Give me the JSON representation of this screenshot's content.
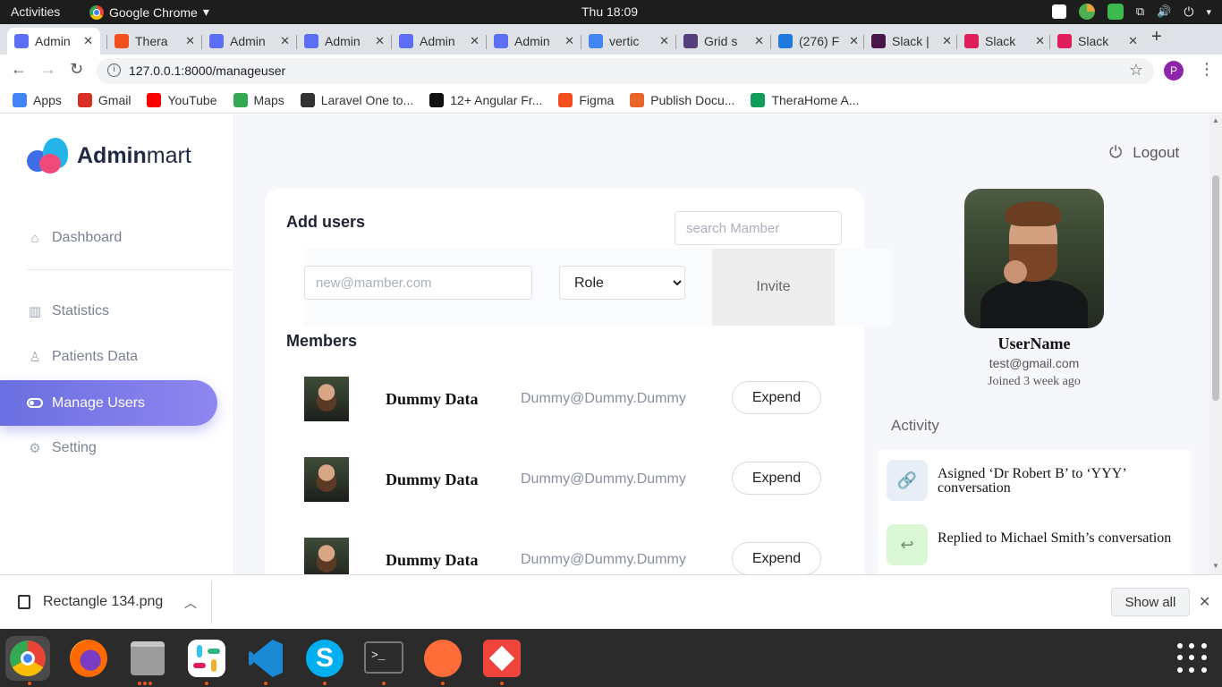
{
  "gnome": {
    "activities": "Activities",
    "app_name": "Google Chrome",
    "app_menu_arrow": "▾",
    "clock": "Thu 18:09"
  },
  "tabs": [
    {
      "title": "Admin",
      "icon": "adminmart-icon",
      "color": "#5b6ef5"
    },
    {
      "title": "Thera",
      "icon": "figma-icon",
      "color": "#f24e1e"
    },
    {
      "title": "Admin",
      "icon": "adminmart-icon",
      "color": "#5b6ef5"
    },
    {
      "title": "Admin",
      "icon": "adminmart-icon",
      "color": "#5b6ef5"
    },
    {
      "title": "Admin",
      "icon": "adminmart-icon",
      "color": "#5b6ef5"
    },
    {
      "title": "Admin",
      "icon": "adminmart-icon",
      "color": "#5b6ef5"
    },
    {
      "title": "vertic",
      "icon": "google-icon",
      "color": "#4285f4"
    },
    {
      "title": "Grid s",
      "icon": "bootstrap-icon",
      "color": "#563d7c"
    },
    {
      "title": "(276) F",
      "icon": "messenger-icon",
      "color": "#1f7ae0"
    },
    {
      "title": "Slack |",
      "icon": "slack-icon",
      "color": "#4a154b"
    },
    {
      "title": "Slack",
      "icon": "slack-icon",
      "color": "#e01e5a"
    },
    {
      "title": "Slack",
      "icon": "slack-icon",
      "color": "#e01e5a"
    }
  ],
  "tab_close": "✕",
  "new_tab": "+",
  "address": {
    "url": "127.0.0.1:8000/manageuser",
    "profile_initial": "P"
  },
  "bookmarks": [
    {
      "label": "Apps",
      "icon": "apps-grid-icon",
      "color": "#4285f4"
    },
    {
      "label": "Gmail",
      "icon": "gmail-icon",
      "color": "#d93025"
    },
    {
      "label": "YouTube",
      "icon": "youtube-icon",
      "color": "#ff0000"
    },
    {
      "label": "Maps",
      "icon": "maps-icon",
      "color": "#34a853"
    },
    {
      "label": "Laravel One to...",
      "icon": "laravel-icon",
      "color": "#333333"
    },
    {
      "label": "12+ Angular Fr...",
      "icon": "bow-icon",
      "color": "#111111"
    },
    {
      "label": "Figma",
      "icon": "figma-icon",
      "color": "#f24e1e"
    },
    {
      "label": "Publish Docu...",
      "icon": "publish-icon",
      "color": "#e8642b"
    },
    {
      "label": "TheraHome A...",
      "icon": "therahome-icon",
      "color": "#0f9d58"
    }
  ],
  "sidebar": {
    "brand_bold": "Admin",
    "brand_light": "mart",
    "items": [
      {
        "label": "Dashboard",
        "icon": "home-icon"
      },
      {
        "label": "Statistics",
        "icon": "bar-chart-icon"
      },
      {
        "label": "Patients Data",
        "icon": "user-icon"
      },
      {
        "label": "Manage Users",
        "icon": "toggle-icon",
        "active": true
      },
      {
        "label": "Setting",
        "icon": "gear-icon"
      }
    ]
  },
  "header": {
    "logout": "Logout"
  },
  "add_users": {
    "title": "Add users",
    "search_placeholder": "search Mamber",
    "email_placeholder": "new@mamber.com",
    "role_selected": "Role",
    "invite_label": "Invite"
  },
  "members": {
    "title": "Members",
    "rows": [
      {
        "name": "Dummy Data",
        "email": "Dummy@Dummy.Dummy",
        "action": "Expend"
      },
      {
        "name": "Dummy Data",
        "email": "Dummy@Dummy.Dummy",
        "action": "Expend"
      },
      {
        "name": "Dummy Data",
        "email": "Dummy@Dummy.Dummy",
        "action": "Expend"
      }
    ]
  },
  "profile": {
    "name": "UserName",
    "email": "test@gmail.com",
    "joined": "Joined 3 week ago"
  },
  "activity": {
    "title": "Activity",
    "items": [
      {
        "text": "Asigned ‘Dr Robert B’ to ‘YYY’ conversation",
        "icon": "link-icon",
        "bg": "#e8eef7",
        "fg": "#7a8aa6"
      },
      {
        "text": "Replied to Michael Smith’s conversation",
        "icon": "reply-icon",
        "bg": "#dcf7d6",
        "fg": "#6b8f63"
      }
    ]
  },
  "downloads": {
    "file": "Rectangle 134.png",
    "show_all": "Show all"
  },
  "colors": {
    "accent": "#6b6fe0",
    "page_bg": "#f5f7fb"
  }
}
